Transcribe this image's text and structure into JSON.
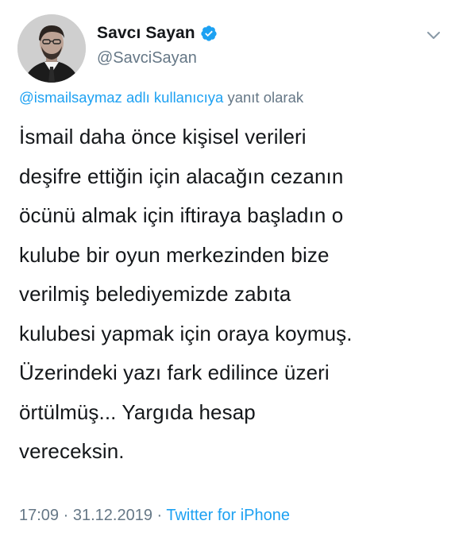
{
  "author": {
    "display_name": "Savcı Sayan",
    "handle": "@SavciSayan",
    "verified_icon": "verified-badge-icon",
    "avatar": "avatar-photo"
  },
  "reply": {
    "mention": "@ismailsaymaz",
    "mention_suffix": "adlı kullanıcıya",
    "suffix": "yanıt olarak"
  },
  "tweet": {
    "text": "İsmail daha önce kişisel verileri\ndeşifre ettiğin için alacağın cezanın\nöcünü almak için iftiraya başladın o\nkulube bir oyun merkezinden bize\nverilmiş belediyemizde zabıta\nkulubesi yapmak için oraya koymuş.\nÜzerindeki yazı fark edilince üzeri\nörtülmüş... Yargıda hesap\nvereceksin."
  },
  "meta": {
    "time": "17:09",
    "separator": " · ",
    "date": "31.12.2019",
    "source": "Twitter for iPhone"
  },
  "colors": {
    "accent": "#1da1f2",
    "secondary_text": "#657786",
    "primary_text": "#14171a"
  },
  "icons": {
    "menu_caret": "chevron-down-icon"
  }
}
